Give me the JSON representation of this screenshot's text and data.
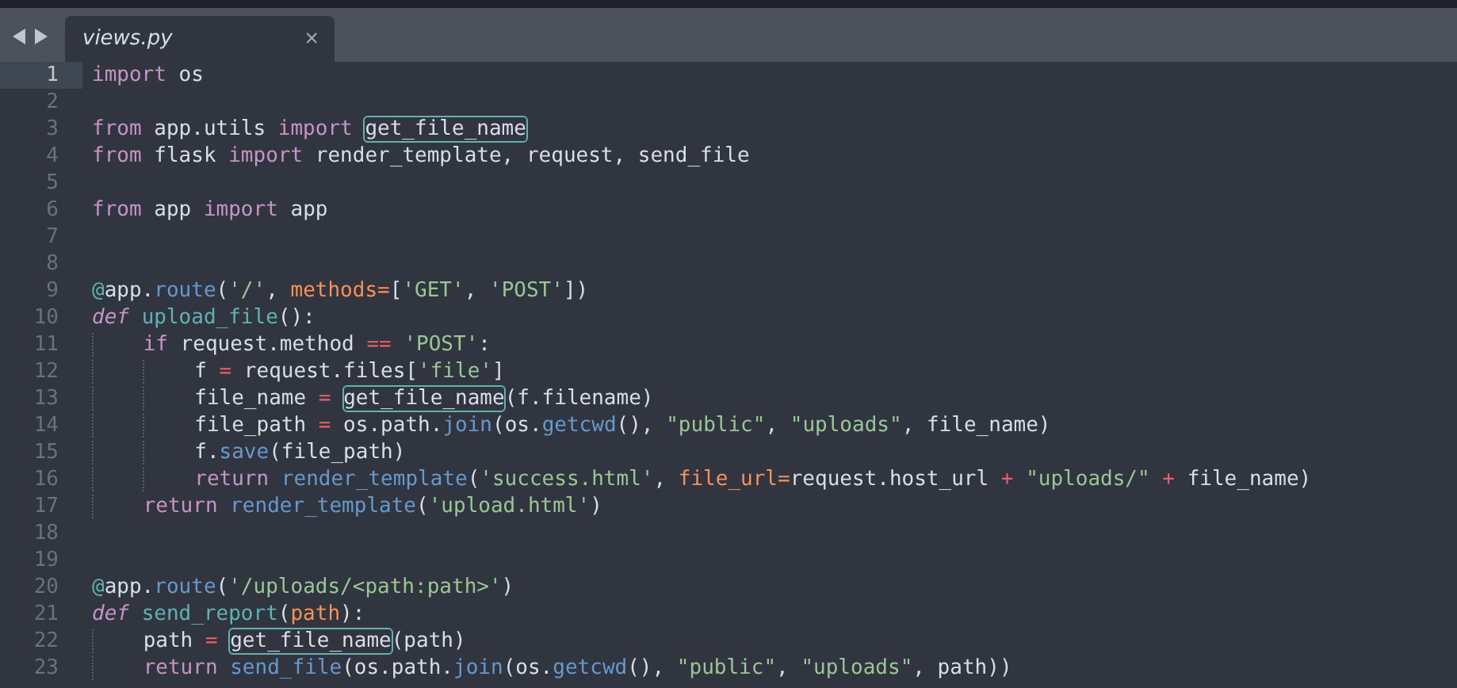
{
  "tabs": [
    {
      "label": "views.py",
      "selected": true,
      "close": "×"
    }
  ],
  "lines": [
    {
      "number": "1",
      "selected": true,
      "tokens": [
        {
          "text": "import",
          "kind": "kw"
        },
        {
          "text": " os",
          "kind": "plain"
        }
      ]
    },
    {
      "number": "2",
      "selected": false
    },
    {
      "number": "3",
      "selected": false,
      "tokens": [
        {
          "text": "from",
          "kind": "kw"
        },
        {
          "text": " app.utils ",
          "kind": "plain"
        },
        {
          "text": "import ",
          "kind": "kw"
        },
        {
          "text": "get_file_name",
          "kind": "match"
        }
      ]
    },
    {
      "number": "4",
      "selected": false,
      "tokens": [
        {
          "text": "from",
          "kind": "kw"
        },
        {
          "text": " flask ",
          "kind": "plain"
        },
        {
          "text": "import",
          "kind": "kw"
        },
        {
          "text": " render_template, request, send_file",
          "kind": "plain"
        }
      ]
    },
    {
      "number": "5",
      "selected": false
    },
    {
      "number": "6",
      "selected": false,
      "tokens": [
        {
          "text": "from",
          "kind": "kw"
        },
        {
          "text": " app ",
          "kind": "plain"
        },
        {
          "text": "import",
          "kind": "kw"
        },
        {
          "text": " app",
          "kind": "plain"
        }
      ]
    },
    {
      "number": "7",
      "selected": false
    },
    {
      "number": "8",
      "selected": false
    },
    {
      "number": "9",
      "selected": false,
      "tokens": [
        {
          "text": "@",
          "kind": "deco"
        },
        {
          "text": "app.",
          "kind": "plain"
        },
        {
          "text": "route",
          "kind": "call"
        },
        {
          "text": "(",
          "kind": "plain"
        },
        {
          "text": "'/'",
          "kind": "str"
        },
        {
          "text": ", ",
          "kind": "plain"
        },
        {
          "text": "methods=",
          "kind": "param"
        },
        {
          "text": "[",
          "kind": "plain"
        },
        {
          "text": "'GET'",
          "kind": "str"
        },
        {
          "text": ", ",
          "kind": "plain"
        },
        {
          "text": "'POST'",
          "kind": "str"
        },
        {
          "text": "])",
          "kind": "plain"
        }
      ]
    },
    {
      "number": "10",
      "selected": false,
      "tokens": [
        {
          "text": "def ",
          "kind": "def"
        },
        {
          "text": "upload_file",
          "kind": "fn"
        },
        {
          "text": "():",
          "kind": "plain"
        }
      ]
    },
    {
      "number": "11",
      "selected": false,
      "tokens": [
        {
          "text": "    if",
          "kind": "kw"
        },
        {
          "text": " request.method ",
          "kind": "plain"
        },
        {
          "text": "== ",
          "kind": "op"
        },
        {
          "text": "'POST'",
          "kind": "str"
        },
        {
          "text": ":",
          "kind": "plain"
        }
      ]
    },
    {
      "number": "12",
      "selected": false,
      "tokens": [
        {
          "text": "        f ",
          "kind": "plain"
        },
        {
          "text": "=",
          "kind": "op"
        },
        {
          "text": " request.files[",
          "kind": "plain"
        },
        {
          "text": "'file'",
          "kind": "str"
        },
        {
          "text": "]",
          "kind": "plain"
        }
      ]
    },
    {
      "number": "13",
      "selected": false,
      "tokens": [
        {
          "text": "        file_name ",
          "kind": "plain"
        },
        {
          "text": "= ",
          "kind": "op"
        },
        {
          "text": "get_file_name",
          "kind": "match"
        },
        {
          "text": "(f.filename)",
          "kind": "plain"
        }
      ]
    },
    {
      "number": "14",
      "selected": false,
      "tokens": [
        {
          "text": "        file_path ",
          "kind": "plain"
        },
        {
          "text": "=",
          "kind": "op"
        },
        {
          "text": " os.path.",
          "kind": "plain"
        },
        {
          "text": "join",
          "kind": "call"
        },
        {
          "text": "(os.",
          "kind": "plain"
        },
        {
          "text": "getcwd",
          "kind": "call"
        },
        {
          "text": "(), ",
          "kind": "plain"
        },
        {
          "text": "\"public\"",
          "kind": "str"
        },
        {
          "text": ", ",
          "kind": "plain"
        },
        {
          "text": "\"uploads\"",
          "kind": "str"
        },
        {
          "text": ", file_name)",
          "kind": "plain"
        }
      ]
    },
    {
      "number": "15",
      "selected": false,
      "tokens": [
        {
          "text": "        f.",
          "kind": "plain"
        },
        {
          "text": "save",
          "kind": "call"
        },
        {
          "text": "(file_path)",
          "kind": "plain"
        }
      ]
    },
    {
      "number": "16",
      "selected": false,
      "tokens": [
        {
          "text": "        return ",
          "kind": "kw"
        },
        {
          "text": "render_template",
          "kind": "call"
        },
        {
          "text": "(",
          "kind": "plain"
        },
        {
          "text": "'success.html'",
          "kind": "str"
        },
        {
          "text": ", ",
          "kind": "plain"
        },
        {
          "text": "file_url=",
          "kind": "param"
        },
        {
          "text": "request.host_url ",
          "kind": "plain"
        },
        {
          "text": "+ ",
          "kind": "op"
        },
        {
          "text": "\"uploads/\"",
          "kind": "str"
        },
        {
          "text": " +",
          "kind": "op"
        },
        {
          "text": " file_name)",
          "kind": "plain"
        }
      ]
    },
    {
      "number": "17",
      "selected": false,
      "tokens": [
        {
          "text": "    return ",
          "kind": "kw"
        },
        {
          "text": "render_template",
          "kind": "call"
        },
        {
          "text": "(",
          "kind": "plain"
        },
        {
          "text": "'upload.html'",
          "kind": "str"
        },
        {
          "text": ")",
          "kind": "plain"
        }
      ]
    },
    {
      "number": "18",
      "selected": false
    },
    {
      "number": "19",
      "selected": false
    },
    {
      "number": "20",
      "selected": false,
      "tokens": [
        {
          "text": "@",
          "kind": "deco"
        },
        {
          "text": "app.",
          "kind": "plain"
        },
        {
          "text": "route",
          "kind": "call"
        },
        {
          "text": "(",
          "kind": "plain"
        },
        {
          "text": "'/uploads/<path:path>'",
          "kind": "str"
        },
        {
          "text": ")",
          "kind": "plain"
        }
      ]
    },
    {
      "number": "21",
      "selected": false,
      "tokens": [
        {
          "text": "def ",
          "kind": "def"
        },
        {
          "text": "send_report",
          "kind": "fn"
        },
        {
          "text": "(",
          "kind": "plain"
        },
        {
          "text": "path",
          "kind": "param"
        },
        {
          "text": "):",
          "kind": "plain"
        }
      ]
    },
    {
      "number": "22",
      "selected": false,
      "tokens": [
        {
          "text": "    path ",
          "kind": "plain"
        },
        {
          "text": "= ",
          "kind": "op"
        },
        {
          "text": "get_file_name",
          "kind": "match"
        },
        {
          "text": "(path)",
          "kind": "plain"
        }
      ]
    },
    {
      "number": "23",
      "selected": false,
      "tokens": [
        {
          "text": "    return ",
          "kind": "kw"
        },
        {
          "text": "send_file",
          "kind": "call"
        },
        {
          "text": "(os.path.",
          "kind": "plain"
        },
        {
          "text": "join",
          "kind": "call"
        },
        {
          "text": "(os.",
          "kind": "plain"
        },
        {
          "text": "getcwd",
          "kind": "call"
        },
        {
          "text": "(), ",
          "kind": "plain"
        },
        {
          "text": "\"public\"",
          "kind": "str"
        },
        {
          "text": ", ",
          "kind": "plain"
        },
        {
          "text": "\"uploads\"",
          "kind": "str"
        },
        {
          "text": ", path))",
          "kind": "plain"
        }
      ]
    }
  ]
}
